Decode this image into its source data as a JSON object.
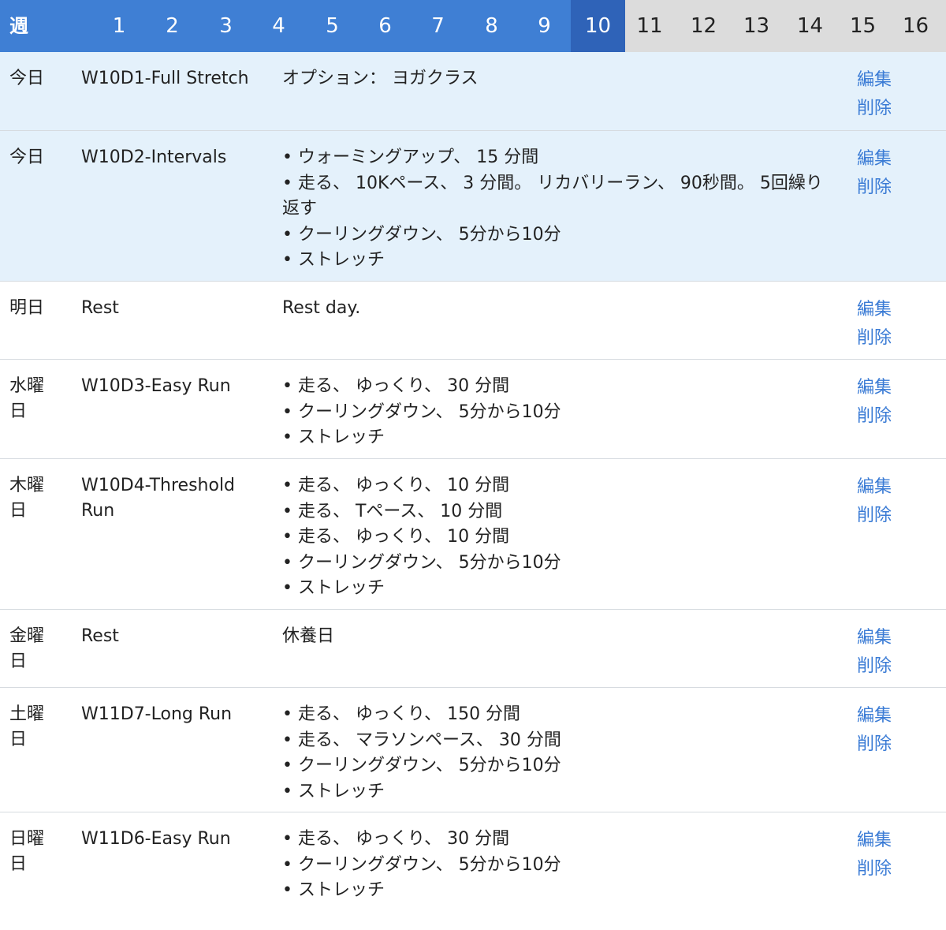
{
  "week_selector": {
    "label": "週",
    "weeks": [
      "1",
      "2",
      "3",
      "4",
      "5",
      "6",
      "7",
      "8",
      "9",
      "10",
      "11",
      "12",
      "13",
      "14",
      "15",
      "16"
    ],
    "current_week": "10"
  },
  "actions": {
    "edit": "編集",
    "delete": "削除"
  },
  "rows": [
    {
      "day": "今日",
      "name": "W10D1-Full Stretch",
      "lines": [
        "オプション： ヨガクラス"
      ]
    },
    {
      "day": "今日",
      "name": "W10D2-Intervals",
      "lines": [
        "• ウォーミングアップ、 15 分間",
        "• 走る、 10Kペース、 3 分間。 リカバリーラン、 90秒間。 5回繰り",
        "返す",
        "• クーリングダウン、 5分から10分",
        "• ストレッチ"
      ]
    },
    {
      "day": "明日",
      "name": "Rest",
      "lines": [
        "Rest day."
      ]
    },
    {
      "day": "水曜日",
      "name": "W10D3-Easy Run",
      "lines": [
        "• 走る、 ゆっくり、 30 分間",
        "• クーリングダウン、 5分から10分",
        "• ストレッチ"
      ]
    },
    {
      "day": "木曜日",
      "name": "W10D4-Threshold Run",
      "lines": [
        "• 走る、 ゆっくり、 10 分間",
        "• 走る、 Tペース、 10 分間",
        "• 走る、 ゆっくり、 10 分間",
        "• クーリングダウン、 5分から10分",
        "• ストレッチ"
      ]
    },
    {
      "day": "金曜日",
      "name": "Rest",
      "lines": [
        "休養日"
      ]
    },
    {
      "day": "土曜日",
      "name": "W11D7-Long Run",
      "lines": [
        "• 走る、 ゆっくり、 150 分間",
        "• 走る、 マラソンペース、 30 分間",
        "• クーリングダウン、 5分から10分",
        "• ストレッチ"
      ]
    },
    {
      "day": "日曜日",
      "name": "W11D6-Easy Run",
      "lines": [
        "• 走る、 ゆっくり、 30 分間",
        "• クーリングダウン、 5分から10分",
        "• ストレッチ"
      ]
    }
  ]
}
